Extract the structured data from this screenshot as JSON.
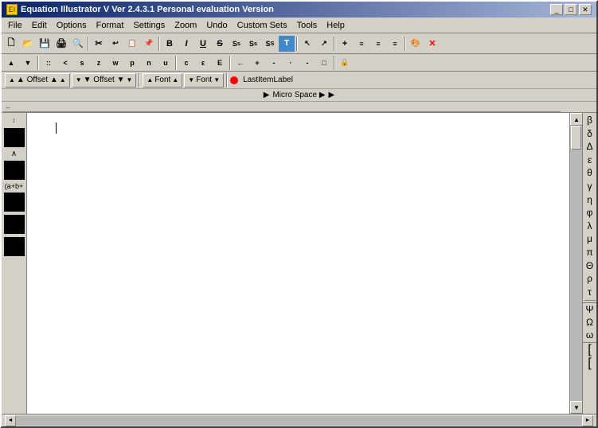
{
  "window": {
    "title": "Equation Illustrator V  Ver 2.4.3.1 Personal evaluation Version",
    "icon": "EI"
  },
  "titlebar": {
    "minimize_label": "_",
    "maximize_label": "□",
    "close_label": "✕"
  },
  "menubar": {
    "items": [
      "File",
      "Edit",
      "Options",
      "Format",
      "Settings",
      "Zoom",
      "Undo",
      "Custom Sets",
      "Tools",
      "Help"
    ]
  },
  "toolbar": {
    "buttons": [
      {
        "id": "new",
        "label": "🗋"
      },
      {
        "id": "open",
        "label": "📂"
      },
      {
        "id": "save",
        "label": "💾"
      },
      {
        "id": "print",
        "label": "🖨"
      },
      {
        "id": "preview",
        "label": "🔍"
      },
      {
        "id": "cut",
        "label": "✂"
      },
      {
        "id": "copy",
        "label": "📋"
      },
      {
        "id": "paste",
        "label": "📌"
      },
      {
        "id": "bold",
        "label": "B"
      },
      {
        "id": "italic",
        "label": "I"
      },
      {
        "id": "underline",
        "label": "U"
      },
      {
        "id": "strikethrough",
        "label": "S"
      },
      {
        "id": "superscript",
        "label": "S⁺"
      },
      {
        "id": "subscript",
        "label": "S₋"
      },
      {
        "id": "sigma",
        "label": "Σ"
      },
      {
        "id": "select",
        "label": "T"
      },
      {
        "id": "arrow",
        "label": "↗"
      },
      {
        "id": "plus",
        "label": "+"
      },
      {
        "id": "align-left",
        "label": "≡"
      },
      {
        "id": "align-center",
        "label": "≡"
      },
      {
        "id": "align-right",
        "label": "≡"
      },
      {
        "id": "color",
        "label": "🎨"
      },
      {
        "id": "close",
        "label": "✕"
      }
    ]
  },
  "toolbar2": {
    "buttons_text": "▲ ▼ :: < s z w p n u c ε E ← + - · - □"
  },
  "sub_toolbar": {
    "offset_up_label": "▲ Offset ▲",
    "offset_down_label": "▼ Offset ▼",
    "font_up_label": "▲ Font ▲",
    "font_down_label": "▼ Font ▼",
    "last_item_label": "LastItemLabel"
  },
  "micro_space": {
    "label": "Micro Space ▶"
  },
  "left_panel": {
    "items": [
      {
        "type": "text",
        "value": "∧"
      },
      {
        "type": "text",
        "value": "(a+b+"
      }
    ]
  },
  "right_symbols": {
    "items": [
      "β",
      "δ",
      "Δ",
      "ε",
      "θ",
      "γ",
      "η",
      "φ",
      "λ",
      "μ",
      "π",
      "Θ",
      "ρ",
      "τ"
    ],
    "bracket_items": [
      "Ψ",
      "Ω",
      "ω"
    ],
    "bracket_chars": [
      "[",
      "["
    ]
  },
  "canvas": {
    "cursor_visible": true
  }
}
